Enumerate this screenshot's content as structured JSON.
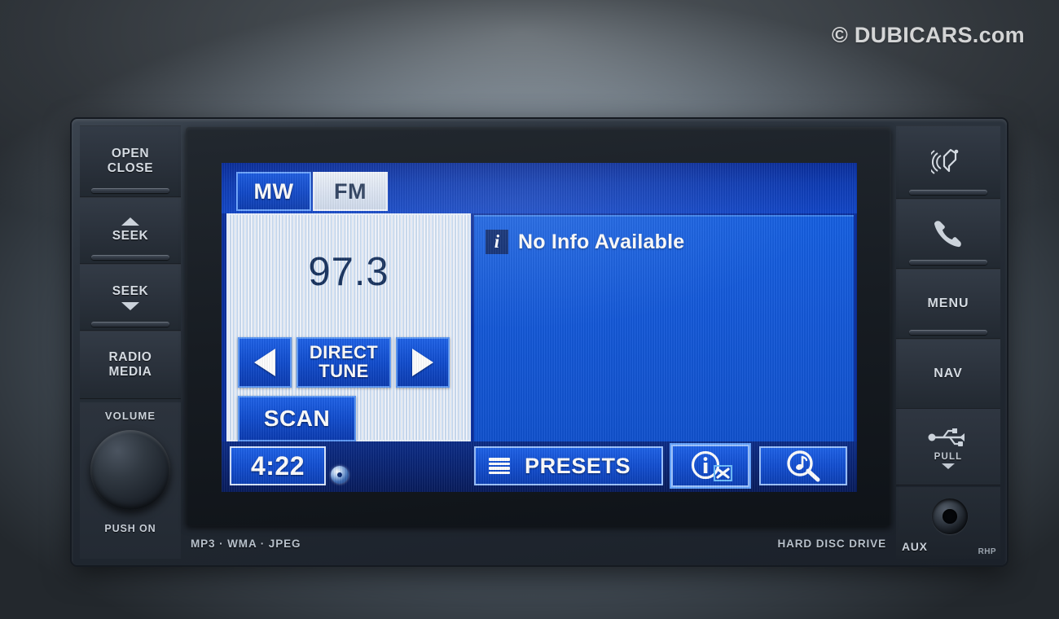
{
  "watermark": "© DUBICARS.com",
  "hardware": {
    "left_buttons": [
      {
        "name": "open-close",
        "line1": "OPEN",
        "line2": "CLOSE"
      },
      {
        "name": "seek-up",
        "line1": "SEEK",
        "line2": ""
      },
      {
        "name": "seek-down",
        "line1": "SEEK",
        "line2": ""
      },
      {
        "name": "radio-media",
        "line1": "RADIO",
        "line2": "MEDIA"
      }
    ],
    "volume": {
      "label": "VOLUME",
      "push_label": "PUSH ON"
    },
    "right_buttons": [
      {
        "name": "voice-command",
        "label": "",
        "icon": "voice-command-icon"
      },
      {
        "name": "phone",
        "label": "",
        "icon": "phone-icon"
      },
      {
        "name": "menu",
        "label": "MENU",
        "icon": ""
      },
      {
        "name": "nav",
        "label": "NAV",
        "icon": ""
      }
    ],
    "usb": {
      "icon": "usb-icon",
      "pull_label": "PULL"
    },
    "aux": {
      "label": "AUX",
      "model_code": "RHP"
    },
    "bottom_strip": {
      "left": "MP3 · WMA · JPEG",
      "right": "HARD DISC DRIVE"
    }
  },
  "screen": {
    "band_tabs": [
      {
        "label": "MW",
        "active": true
      },
      {
        "label": "FM",
        "active": false
      }
    ],
    "tuner": {
      "frequency": "97.3",
      "tune_down_icon": "triangle-left-icon",
      "direct_tune_line1": "DIRECT",
      "direct_tune_line2": "TUNE",
      "tune_up_icon": "triangle-right-icon",
      "scan_label": "SCAN"
    },
    "info": {
      "badge": "i",
      "message": "No Info Available"
    },
    "bottom": {
      "clock": "4:22",
      "disc_icon": "disc-icon",
      "presets_label": "PRESETS",
      "presets_icon": "hamburger-icon",
      "info_close_icon": "info-close-icon",
      "music_search_icon": "music-search-icon"
    }
  },
  "colors": {
    "screen_blue": "#1458d8",
    "button_blue": "#134fd2",
    "tab_active": "#0f47c8",
    "tuner_panel_bg": "#e6eefa",
    "frequency_text": "#16315e"
  }
}
